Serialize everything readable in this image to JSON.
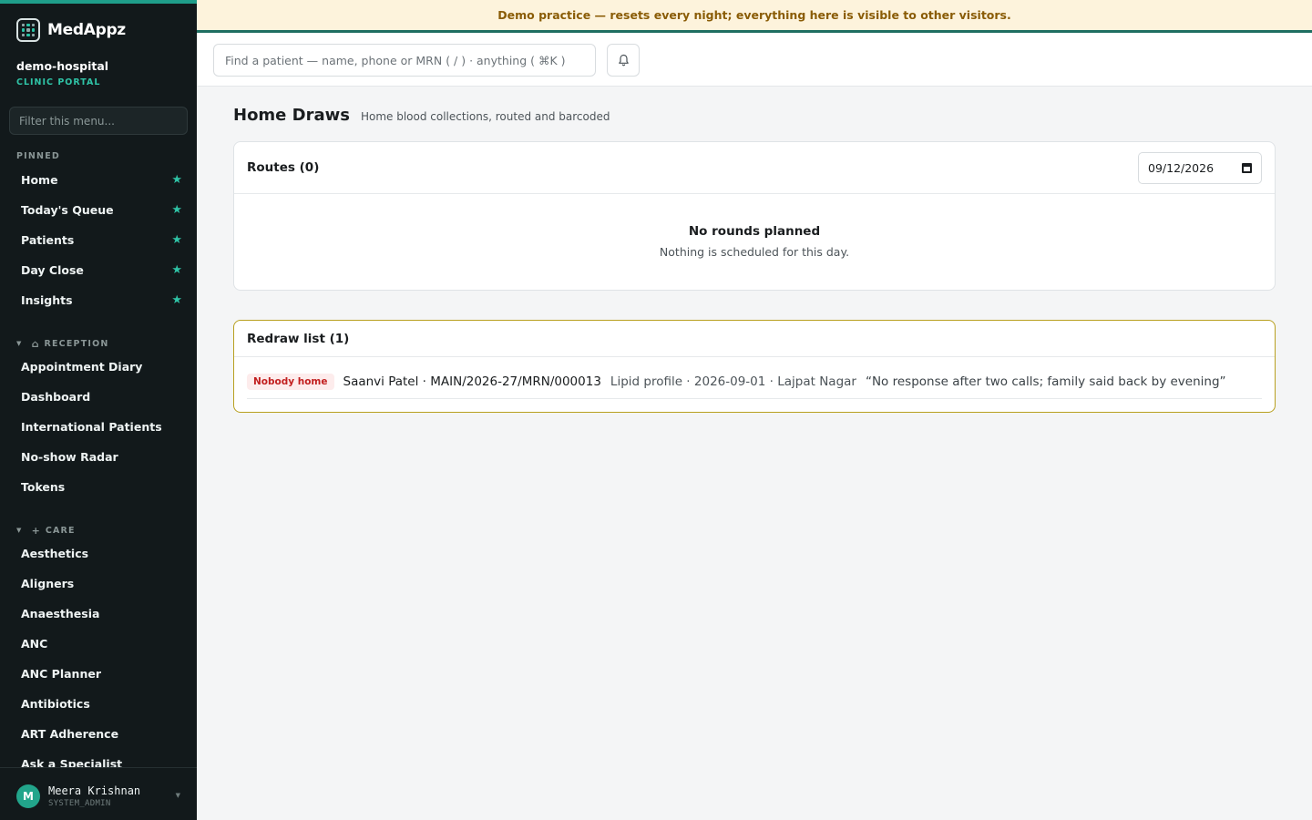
{
  "brand": {
    "name": "MedAppz"
  },
  "org": {
    "name": "demo-hospital",
    "subtitle": "CLINIC PORTAL"
  },
  "sidebar": {
    "filter_placeholder": "Filter this menu...",
    "pinned": {
      "heading": "PINNED",
      "items": [
        {
          "label": "Home",
          "icon": "star-icon"
        },
        {
          "label": "Today's Queue",
          "icon": "star-icon"
        },
        {
          "label": "Patients",
          "icon": "star-icon"
        },
        {
          "label": "Day Close",
          "icon": "star-icon"
        },
        {
          "label": "Insights",
          "icon": "star-icon"
        }
      ]
    },
    "reception": {
      "heading": "RECEPTION",
      "icon": "home-icon",
      "items": [
        "Appointment Diary",
        "Dashboard",
        "International Patients",
        "No-show Radar",
        "Tokens"
      ]
    },
    "care": {
      "heading": "CARE",
      "icon": "plus-icon",
      "items": [
        "Aesthetics",
        "Aligners",
        "Anaesthesia",
        "ANC",
        "ANC Planner",
        "Antibiotics",
        "ART Adherence",
        "Ask a Specialist"
      ]
    },
    "pin_glyph": "★"
  },
  "user": {
    "initial": "M",
    "name": "Meera Krishnan",
    "role": "SYSTEM_ADMIN"
  },
  "banner": {
    "text": "Demo practice — resets every night; everything here is visible to other visitors."
  },
  "topbar": {
    "search_placeholder": "Find a patient — name, phone or MRN ( / ) · anything ( ⌘K )",
    "bell_icon": "bell-icon"
  },
  "page": {
    "title": "Home Draws",
    "subtitle": "Home blood collections, routed and barcoded"
  },
  "routes": {
    "title": "Routes (0)",
    "date": "09/12/2026",
    "empty_title": "No rounds planned",
    "empty_subtitle": "Nothing is scheduled for this day."
  },
  "redraw": {
    "title": "Redraw list (1)",
    "rows": [
      {
        "badge": "Nobody home",
        "patient": "Saanvi Patel · MAIN/2026-27/MRN/000013",
        "meta": "Lipid profile · 2026-09-01 · Lajpat Nagar",
        "note": "“No response after two calls; family said back by evening”"
      }
    ]
  },
  "colors": {
    "accent": "#1f9e8a",
    "sidebar_bg": "#12191b",
    "banner_bg": "#fdf3dc",
    "banner_text": "#8a5c06",
    "badge_red": "#c21f1f",
    "redraw_border": "#b8a020"
  }
}
